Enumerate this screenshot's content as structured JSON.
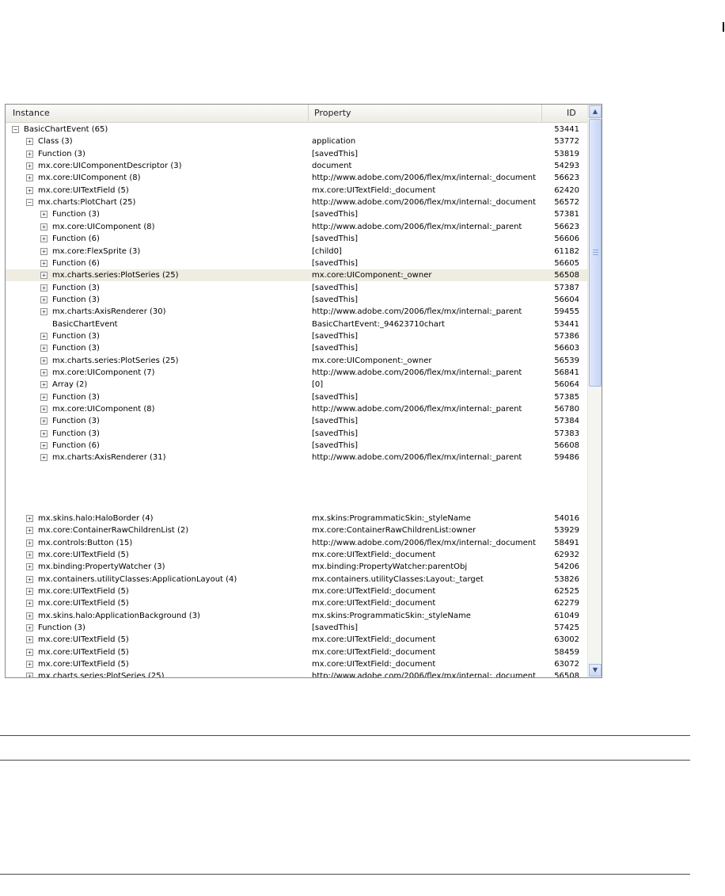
{
  "columns": {
    "instance": "Instance",
    "property": "Property",
    "id": "ID"
  },
  "rows": [
    {
      "indent": 0,
      "toggle": "−",
      "instance": "BasicChartEvent (65)",
      "property": "",
      "id": "53441"
    },
    {
      "indent": 1,
      "toggle": "+",
      "instance": "Class (3)",
      "property": "application",
      "id": "53772"
    },
    {
      "indent": 1,
      "toggle": "+",
      "instance": "Function (3)",
      "property": "[savedThis]",
      "id": "53819"
    },
    {
      "indent": 1,
      "toggle": "+",
      "instance": "mx.core:UIComponentDescriptor (3)",
      "property": "document",
      "id": "54293"
    },
    {
      "indent": 1,
      "toggle": "+",
      "instance": "mx.core:UIComponent (8)",
      "property": "http://www.adobe.com/2006/flex/mx/internal:_document",
      "id": "56623"
    },
    {
      "indent": 1,
      "toggle": "+",
      "instance": "mx.core:UITextField (5)",
      "property": "mx.core:UITextField:_document",
      "id": "62420"
    },
    {
      "indent": 1,
      "toggle": "−",
      "instance": "mx.charts:PlotChart (25)",
      "property": "http://www.adobe.com/2006/flex/mx/internal:_document",
      "id": "56572"
    },
    {
      "indent": 2,
      "toggle": "+",
      "instance": "Function (3)",
      "property": "[savedThis]",
      "id": "57381"
    },
    {
      "indent": 2,
      "toggle": "+",
      "instance": "mx.core:UIComponent (8)",
      "property": "http://www.adobe.com/2006/flex/mx/internal:_parent",
      "id": "56623"
    },
    {
      "indent": 2,
      "toggle": "+",
      "instance": "Function (6)",
      "property": "[savedThis]",
      "id": "56606"
    },
    {
      "indent": 2,
      "toggle": "+",
      "instance": "mx.core:FlexSprite (3)",
      "property": "[child0]",
      "id": "61182"
    },
    {
      "indent": 2,
      "toggle": "+",
      "instance": "Function (6)",
      "property": "[savedThis]",
      "id": "56605"
    },
    {
      "indent": 2,
      "toggle": "+",
      "instance": "mx.charts.series:PlotSeries (25)",
      "property": "mx.core:UIComponent:_owner",
      "id": "56508",
      "selected": true
    },
    {
      "indent": 2,
      "toggle": "+",
      "instance": "Function (3)",
      "property": "[savedThis]",
      "id": "57387"
    },
    {
      "indent": 2,
      "toggle": "+",
      "instance": "Function (3)",
      "property": "[savedThis]",
      "id": "56604"
    },
    {
      "indent": 2,
      "toggle": "+",
      "instance": "mx.charts:AxisRenderer (30)",
      "property": "http://www.adobe.com/2006/flex/mx/internal:_parent",
      "id": "59455"
    },
    {
      "indent": 2,
      "toggle": "",
      "instance": "BasicChartEvent",
      "property": "BasicChartEvent:_94623710chart",
      "id": "53441"
    },
    {
      "indent": 2,
      "toggle": "+",
      "instance": "Function (3)",
      "property": "[savedThis]",
      "id": "57386"
    },
    {
      "indent": 2,
      "toggle": "+",
      "instance": "Function (3)",
      "property": "[savedThis]",
      "id": "56603"
    },
    {
      "indent": 2,
      "toggle": "+",
      "instance": "mx.charts.series:PlotSeries (25)",
      "property": "mx.core:UIComponent:_owner",
      "id": "56539"
    },
    {
      "indent": 2,
      "toggle": "+",
      "instance": "mx.core:UIComponent (7)",
      "property": "http://www.adobe.com/2006/flex/mx/internal:_parent",
      "id": "56841"
    },
    {
      "indent": 2,
      "toggle": "+",
      "instance": "Array (2)",
      "property": "[0]",
      "id": "56064"
    },
    {
      "indent": 2,
      "toggle": "+",
      "instance": "Function (3)",
      "property": "[savedThis]",
      "id": "57385"
    },
    {
      "indent": 2,
      "toggle": "+",
      "instance": "mx.core:UIComponent (8)",
      "property": "http://www.adobe.com/2006/flex/mx/internal:_parent",
      "id": "56780"
    },
    {
      "indent": 2,
      "toggle": "+",
      "instance": "Function (3)",
      "property": "[savedThis]",
      "id": "57384"
    },
    {
      "indent": 2,
      "toggle": "+",
      "instance": "Function (3)",
      "property": "[savedThis]",
      "id": "57383"
    },
    {
      "indent": 2,
      "toggle": "+",
      "instance": "Function (6)",
      "property": "[savedThis]",
      "id": "56608"
    },
    {
      "indent": 2,
      "toggle": "+",
      "instance": "mx.charts:AxisRenderer (31)",
      "property": "http://www.adobe.com/2006/flex/mx/internal:_parent",
      "id": "59486"
    },
    {
      "indent": 1,
      "toggle": "+",
      "instance": "mx.skins.halo:HaloBorder (4)",
      "property": "mx.skins:ProgrammaticSkin:_styleName",
      "id": "54016"
    },
    {
      "indent": 1,
      "toggle": "+",
      "instance": "mx.core:ContainerRawChildrenList (2)",
      "property": "mx.core:ContainerRawChildrenList:owner",
      "id": "53929"
    },
    {
      "indent": 1,
      "toggle": "+",
      "instance": "mx.controls:Button (15)",
      "property": "http://www.adobe.com/2006/flex/mx/internal:_document",
      "id": "58491"
    },
    {
      "indent": 1,
      "toggle": "+",
      "instance": "mx.core:UITextField (5)",
      "property": "mx.core:UITextField:_document",
      "id": "62932"
    },
    {
      "indent": 1,
      "toggle": "+",
      "instance": "mx.binding:PropertyWatcher (3)",
      "property": "mx.binding:PropertyWatcher:parentObj",
      "id": "54206"
    },
    {
      "indent": 1,
      "toggle": "+",
      "instance": "mx.containers.utilityClasses:ApplicationLayout (4)",
      "property": "mx.containers.utilityClasses:Layout:_target",
      "id": "53826"
    },
    {
      "indent": 1,
      "toggle": "+",
      "instance": "mx.core:UITextField (5)",
      "property": "mx.core:UITextField:_document",
      "id": "62525"
    },
    {
      "indent": 1,
      "toggle": "+",
      "instance": "mx.core:UITextField (5)",
      "property": "mx.core:UITextField:_document",
      "id": "62279"
    },
    {
      "indent": 1,
      "toggle": "+",
      "instance": "mx.skins.halo:ApplicationBackground (3)",
      "property": "mx.skins:ProgrammaticSkin:_styleName",
      "id": "61049"
    },
    {
      "indent": 1,
      "toggle": "+",
      "instance": "Function (3)",
      "property": "[savedThis]",
      "id": "57425"
    },
    {
      "indent": 1,
      "toggle": "+",
      "instance": "mx.core:UITextField (5)",
      "property": "mx.core:UITextField:_document",
      "id": "63002"
    },
    {
      "indent": 1,
      "toggle": "+",
      "instance": "mx.core:UITextField (5)",
      "property": "mx.core:UITextField:_document",
      "id": "58459"
    },
    {
      "indent": 1,
      "toggle": "+",
      "instance": "mx.core:UITextField (5)",
      "property": "mx.core:UITextField:_document",
      "id": "63072"
    },
    {
      "indent": 1,
      "toggle": "+",
      "instance": "mx.charts.series:PlotSeries (25)",
      "property": "http://www.adobe.com/2006/flex/mx/internal:_document",
      "id": "56508"
    }
  ],
  "scrollbar": {
    "up_icon": "▲",
    "down_icon": "▼"
  }
}
